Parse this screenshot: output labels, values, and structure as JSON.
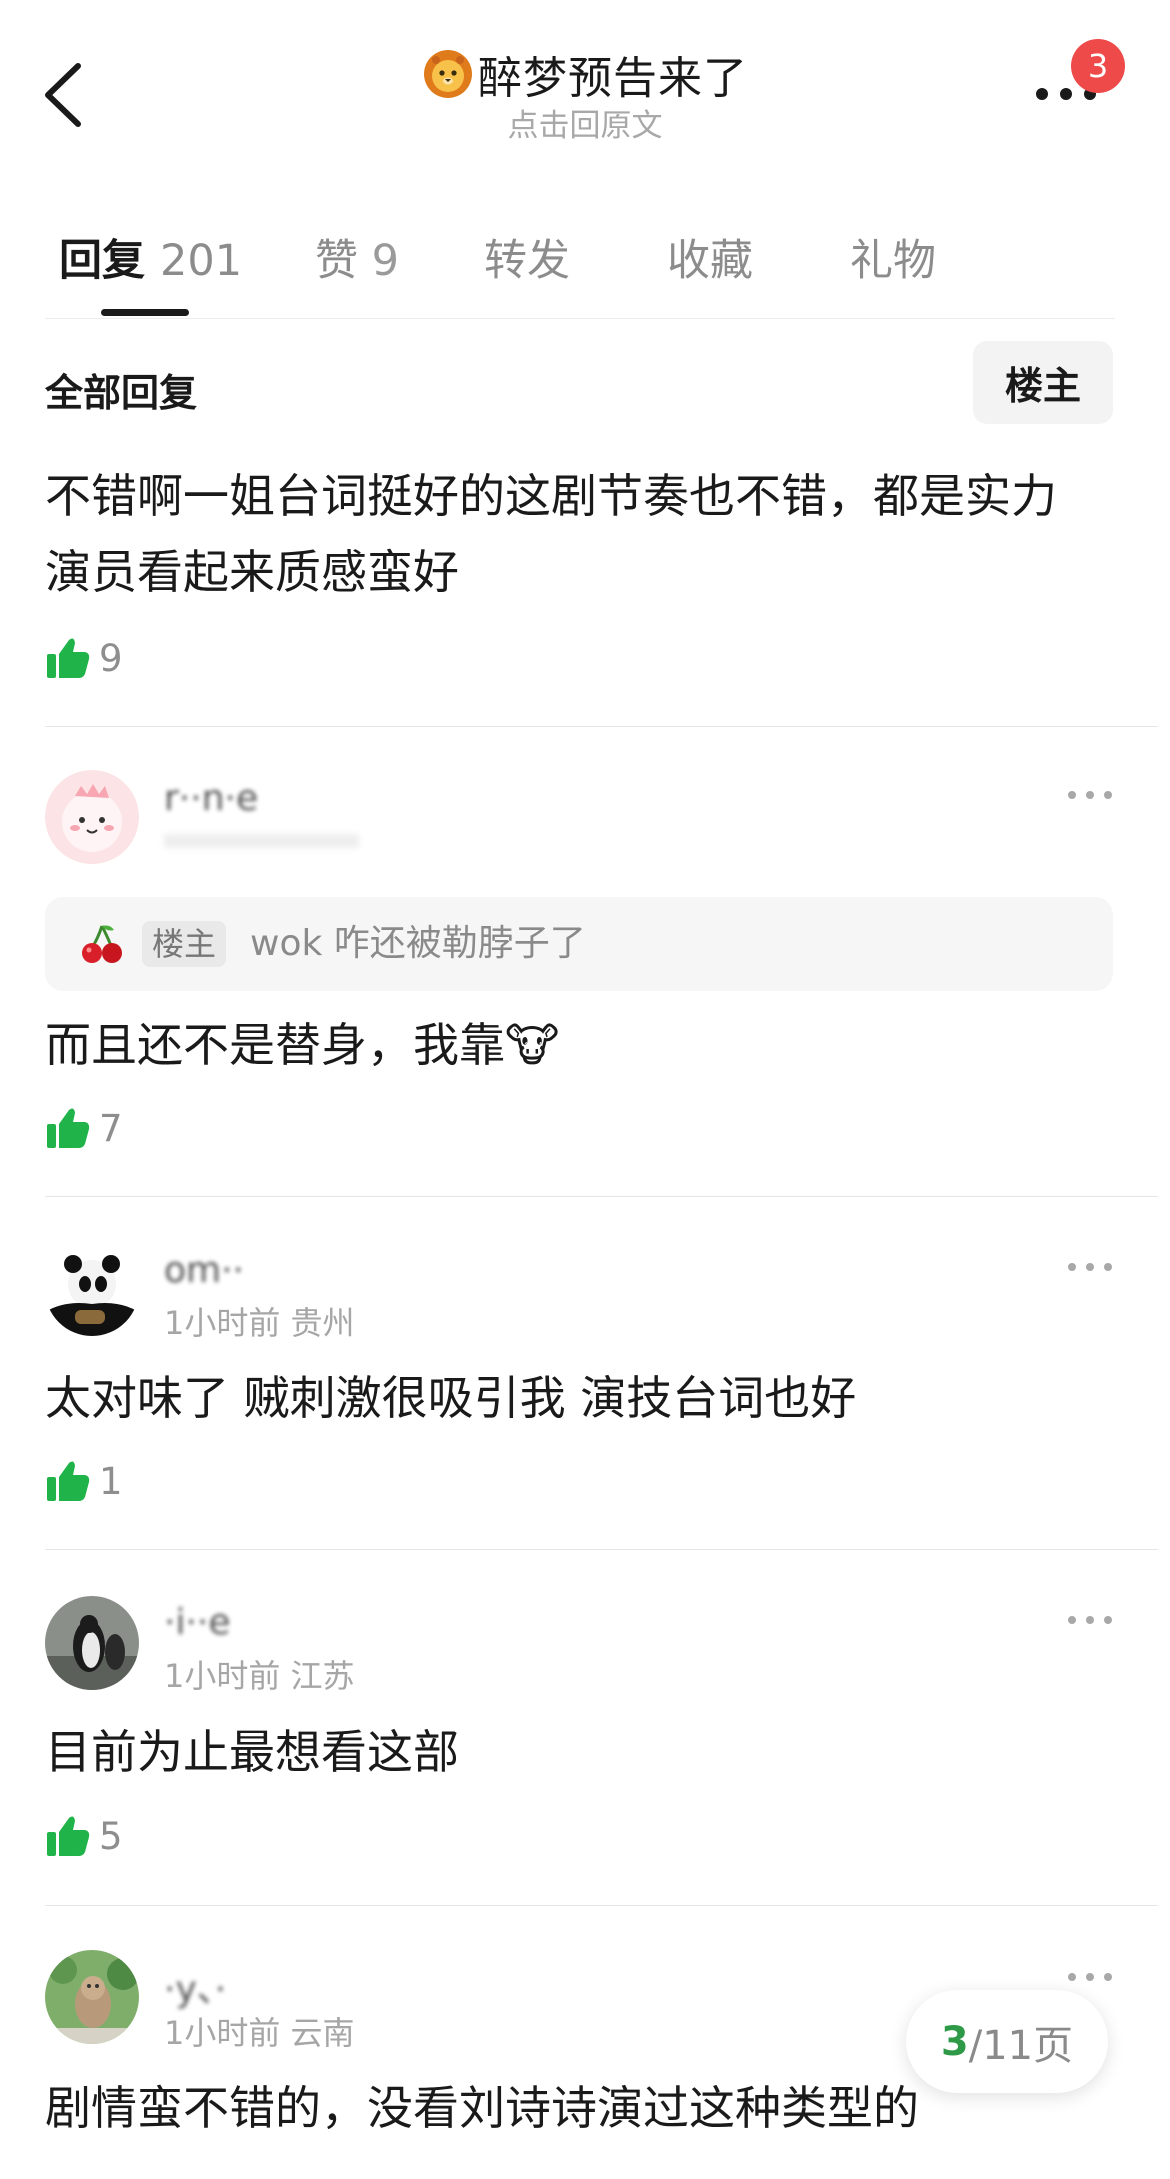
{
  "header": {
    "title": "醉梦预告来了",
    "subtitle": "点击回原文",
    "badge_count": "3"
  },
  "tabs": [
    {
      "label": "回复",
      "count": "201",
      "active": true
    },
    {
      "label": "赞",
      "count": "9",
      "active": false
    },
    {
      "label": "转发",
      "count": "",
      "active": false
    },
    {
      "label": "收藏",
      "count": "",
      "active": false
    },
    {
      "label": "礼物",
      "count": "",
      "active": false
    }
  ],
  "section": {
    "title": "全部回复",
    "owner_filter": "楼主"
  },
  "original_comment": {
    "text_line1": "不错啊一姐台词挺好的这剧节奏也不错，都是实力",
    "text_line2": "演员看起来质感蛮好",
    "likes": "9"
  },
  "replies": [
    {
      "username": "r··n·e",
      "meta": "",
      "quote_tag": "楼主",
      "quote_text": "wok 咋还被勒脖子了",
      "text": "而且还不是替身，我靠🐮",
      "likes": "7"
    },
    {
      "username": "om··",
      "meta": "1小时前 贵州",
      "text": "太对味了 贼刺激很吸引我  演技台词也好",
      "likes": "1"
    },
    {
      "username": "·i··e",
      "meta": "1小时前 江苏",
      "text": "目前为止最想看这部",
      "likes": "5"
    },
    {
      "username": "·y、·",
      "meta": "1小时前 云南",
      "text": "剧情蛮不错的，没看刘诗诗演过这种类型的",
      "likes": ""
    }
  ],
  "pager": {
    "current": "3",
    "rest": "/11页"
  },
  "colors": {
    "accent_green": "#2e9a48",
    "badge_red": "#ef4a4a",
    "thumb_green": "#20b34a"
  },
  "icons": {
    "back": "chevron-left-icon",
    "more": "more-dots-icon",
    "like": "thumbs-up-icon",
    "quote": "cherry-icon",
    "title": "lion-emoji-icon"
  }
}
